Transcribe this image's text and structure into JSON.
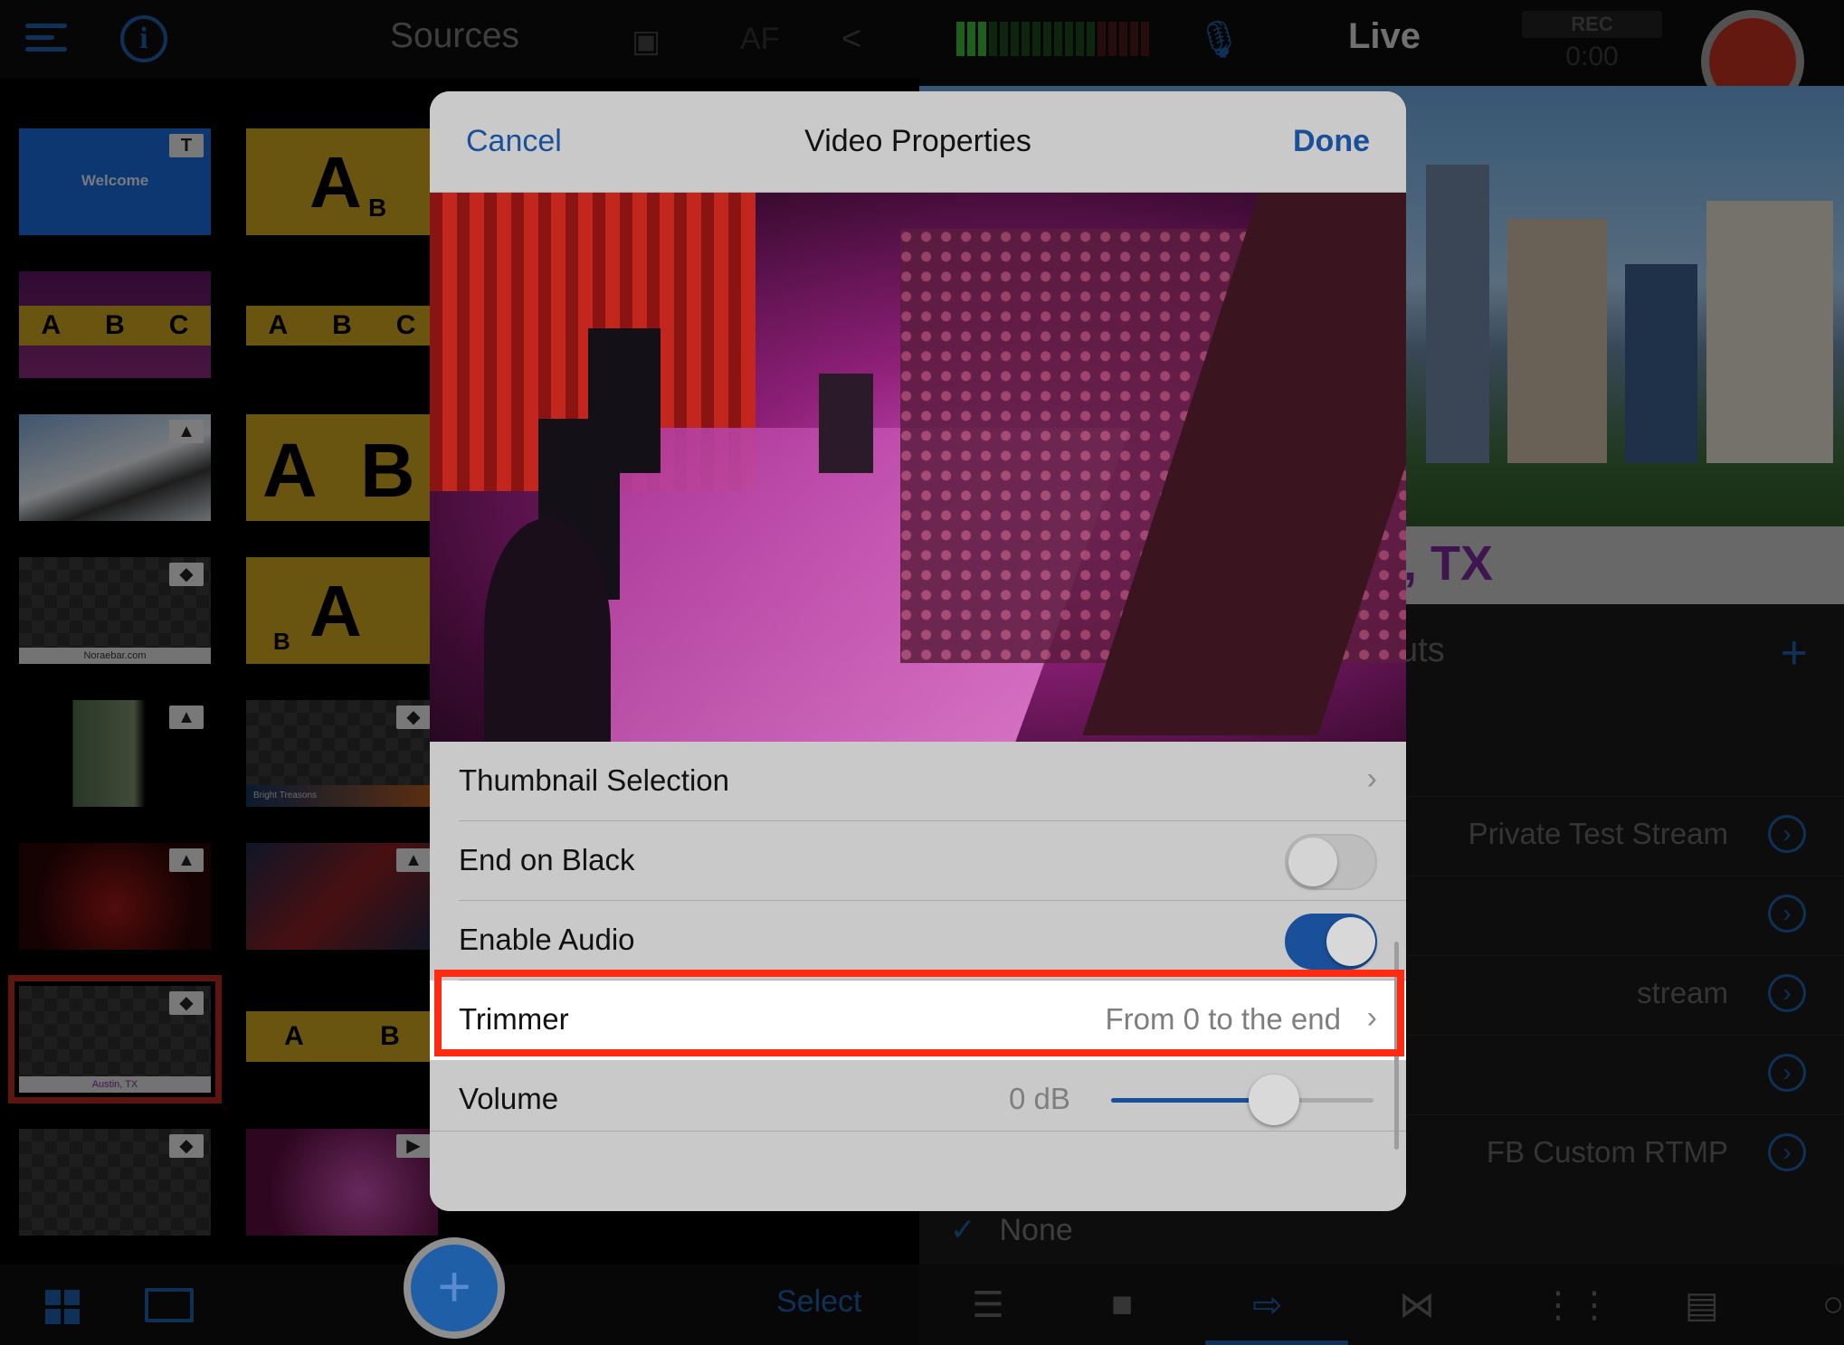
{
  "topbar": {
    "sources_title": "Sources",
    "af_label": "AF",
    "live_title": "Live",
    "rec_label": "REC",
    "rec_time": "0:00",
    "icons": [
      "menu-icon",
      "info-icon",
      "camera-flip-icon",
      "share-icon",
      "mic-muted-icon",
      "record-icon"
    ]
  },
  "sources": {
    "tiles": [
      {
        "label": "Welcome",
        "badge": "T"
      },
      {
        "label": "A B",
        "badge": ""
      },
      {
        "label": "A B C",
        "badge": ""
      },
      {
        "label": "A B C",
        "badge": ""
      },
      {
        "label": "",
        "badge": "image"
      },
      {
        "label": "A/B",
        "badge": ""
      },
      {
        "label": "Noraebar.com",
        "badge": "layer"
      },
      {
        "label": "A B",
        "badge": ""
      },
      {
        "label": "",
        "badge": "image"
      },
      {
        "label": "Bright Treasons",
        "badge": "layer"
      },
      {
        "label": "",
        "badge": "image"
      },
      {
        "label": "",
        "badge": "image"
      },
      {
        "label": "Austin, TX",
        "badge": "layer",
        "selected": true
      },
      {
        "label": "A B",
        "badge": ""
      },
      {
        "label": "",
        "badge": "layer"
      },
      {
        "label": "",
        "badge": "video"
      }
    ],
    "tile_text": {
      "welcome": "Welcome",
      "t_badge": "T",
      "a": "A",
      "b": "B",
      "c": "C",
      "noraebar": "Noraebar.com",
      "bright_treasons": "Bright Treasons",
      "austin": "Austin, TX"
    }
  },
  "live": {
    "caption_fragment": ", TX",
    "outputs_fragment": "uts",
    "outputs": [
      {
        "label": "Private Test Stream"
      },
      {
        "label": ""
      },
      {
        "label": "stream"
      },
      {
        "label": ""
      },
      {
        "label": "FB Custom RTMP"
      }
    ],
    "none_label": "None",
    "check_mark": "✓"
  },
  "bottom": {
    "select_label": "Select",
    "tab_icons": [
      "mixer-icon",
      "camera-icon",
      "output-icon",
      "transition-icon",
      "audio-icon",
      "stats-icon",
      "chat-icon"
    ]
  },
  "modal": {
    "cancel": "Cancel",
    "title": "Video Properties",
    "done": "Done",
    "rows": {
      "thumbnail": "Thumbnail Selection",
      "end_on_black": "End on Black",
      "enable_audio": "Enable Audio",
      "trimmer": "Trimmer",
      "trimmer_value": "From 0 to the end",
      "volume": "Volume",
      "volume_value": "0 dB"
    },
    "end_on_black_enabled": false,
    "enable_audio_enabled": true,
    "volume_level": 0.62
  },
  "colors": {
    "accent": "#1a4f99",
    "record": "#c0301f",
    "highlight": "#ff2a12",
    "caption_text": "#7a2a9a",
    "tile_yellow": "#c9a21f"
  }
}
